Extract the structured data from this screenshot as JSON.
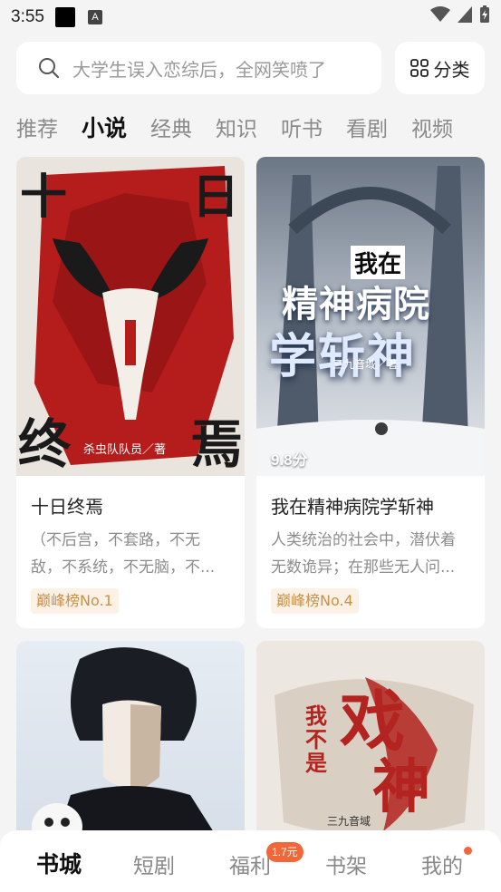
{
  "status_bar": {
    "time": "3:55"
  },
  "search": {
    "placeholder_text": "大学生误入恋综后，全网笑喷了"
  },
  "category_button": {
    "label": "分类"
  },
  "tabs": [
    {
      "label": "推荐"
    },
    {
      "label": "小说"
    },
    {
      "label": "经典"
    },
    {
      "label": "知识"
    },
    {
      "label": "听书"
    },
    {
      "label": "看剧"
    },
    {
      "label": "视频"
    }
  ],
  "active_tab": "小说",
  "books": [
    {
      "title": "十日终焉",
      "desc_line1": "（不后宫，不套路，不无",
      "desc_line2": "敌，不系统，不无脑，不...",
      "rank": "巅峰榜No.1",
      "cover_title_top_left": "十",
      "cover_title_top_right": "日",
      "cover_title_bottom_left": "终",
      "cover_title_bottom_right": "焉",
      "cover_author": "杀虫队队员／著"
    },
    {
      "title": "我在精神病院学斩神",
      "desc_line1": "人类统治的社会中，潜伏着",
      "desc_line2": "无数诡异；在那些无人问...",
      "rank": "巅峰榜No.4",
      "score": "9.8分",
      "cover_line1": "我在",
      "cover_line2": "精神病院",
      "cover_line3": "学斩神",
      "cover_author": "三九音域／著"
    },
    {
      "title": ""
    },
    {
      "cover_line1": "我不是",
      "cover_line2": "戏",
      "cover_line3": "神",
      "cover_author": "三九音域"
    }
  ],
  "bottom_nav": [
    {
      "label": "书城"
    },
    {
      "label": "短剧"
    },
    {
      "label": "福利"
    },
    {
      "label": "书架"
    },
    {
      "label": "我的"
    }
  ],
  "welfare_badge": "1.7元",
  "colors": {
    "accent": "#f0673a",
    "rank_text": "#c9904a",
    "rank_bg": "#fbf1e4"
  }
}
